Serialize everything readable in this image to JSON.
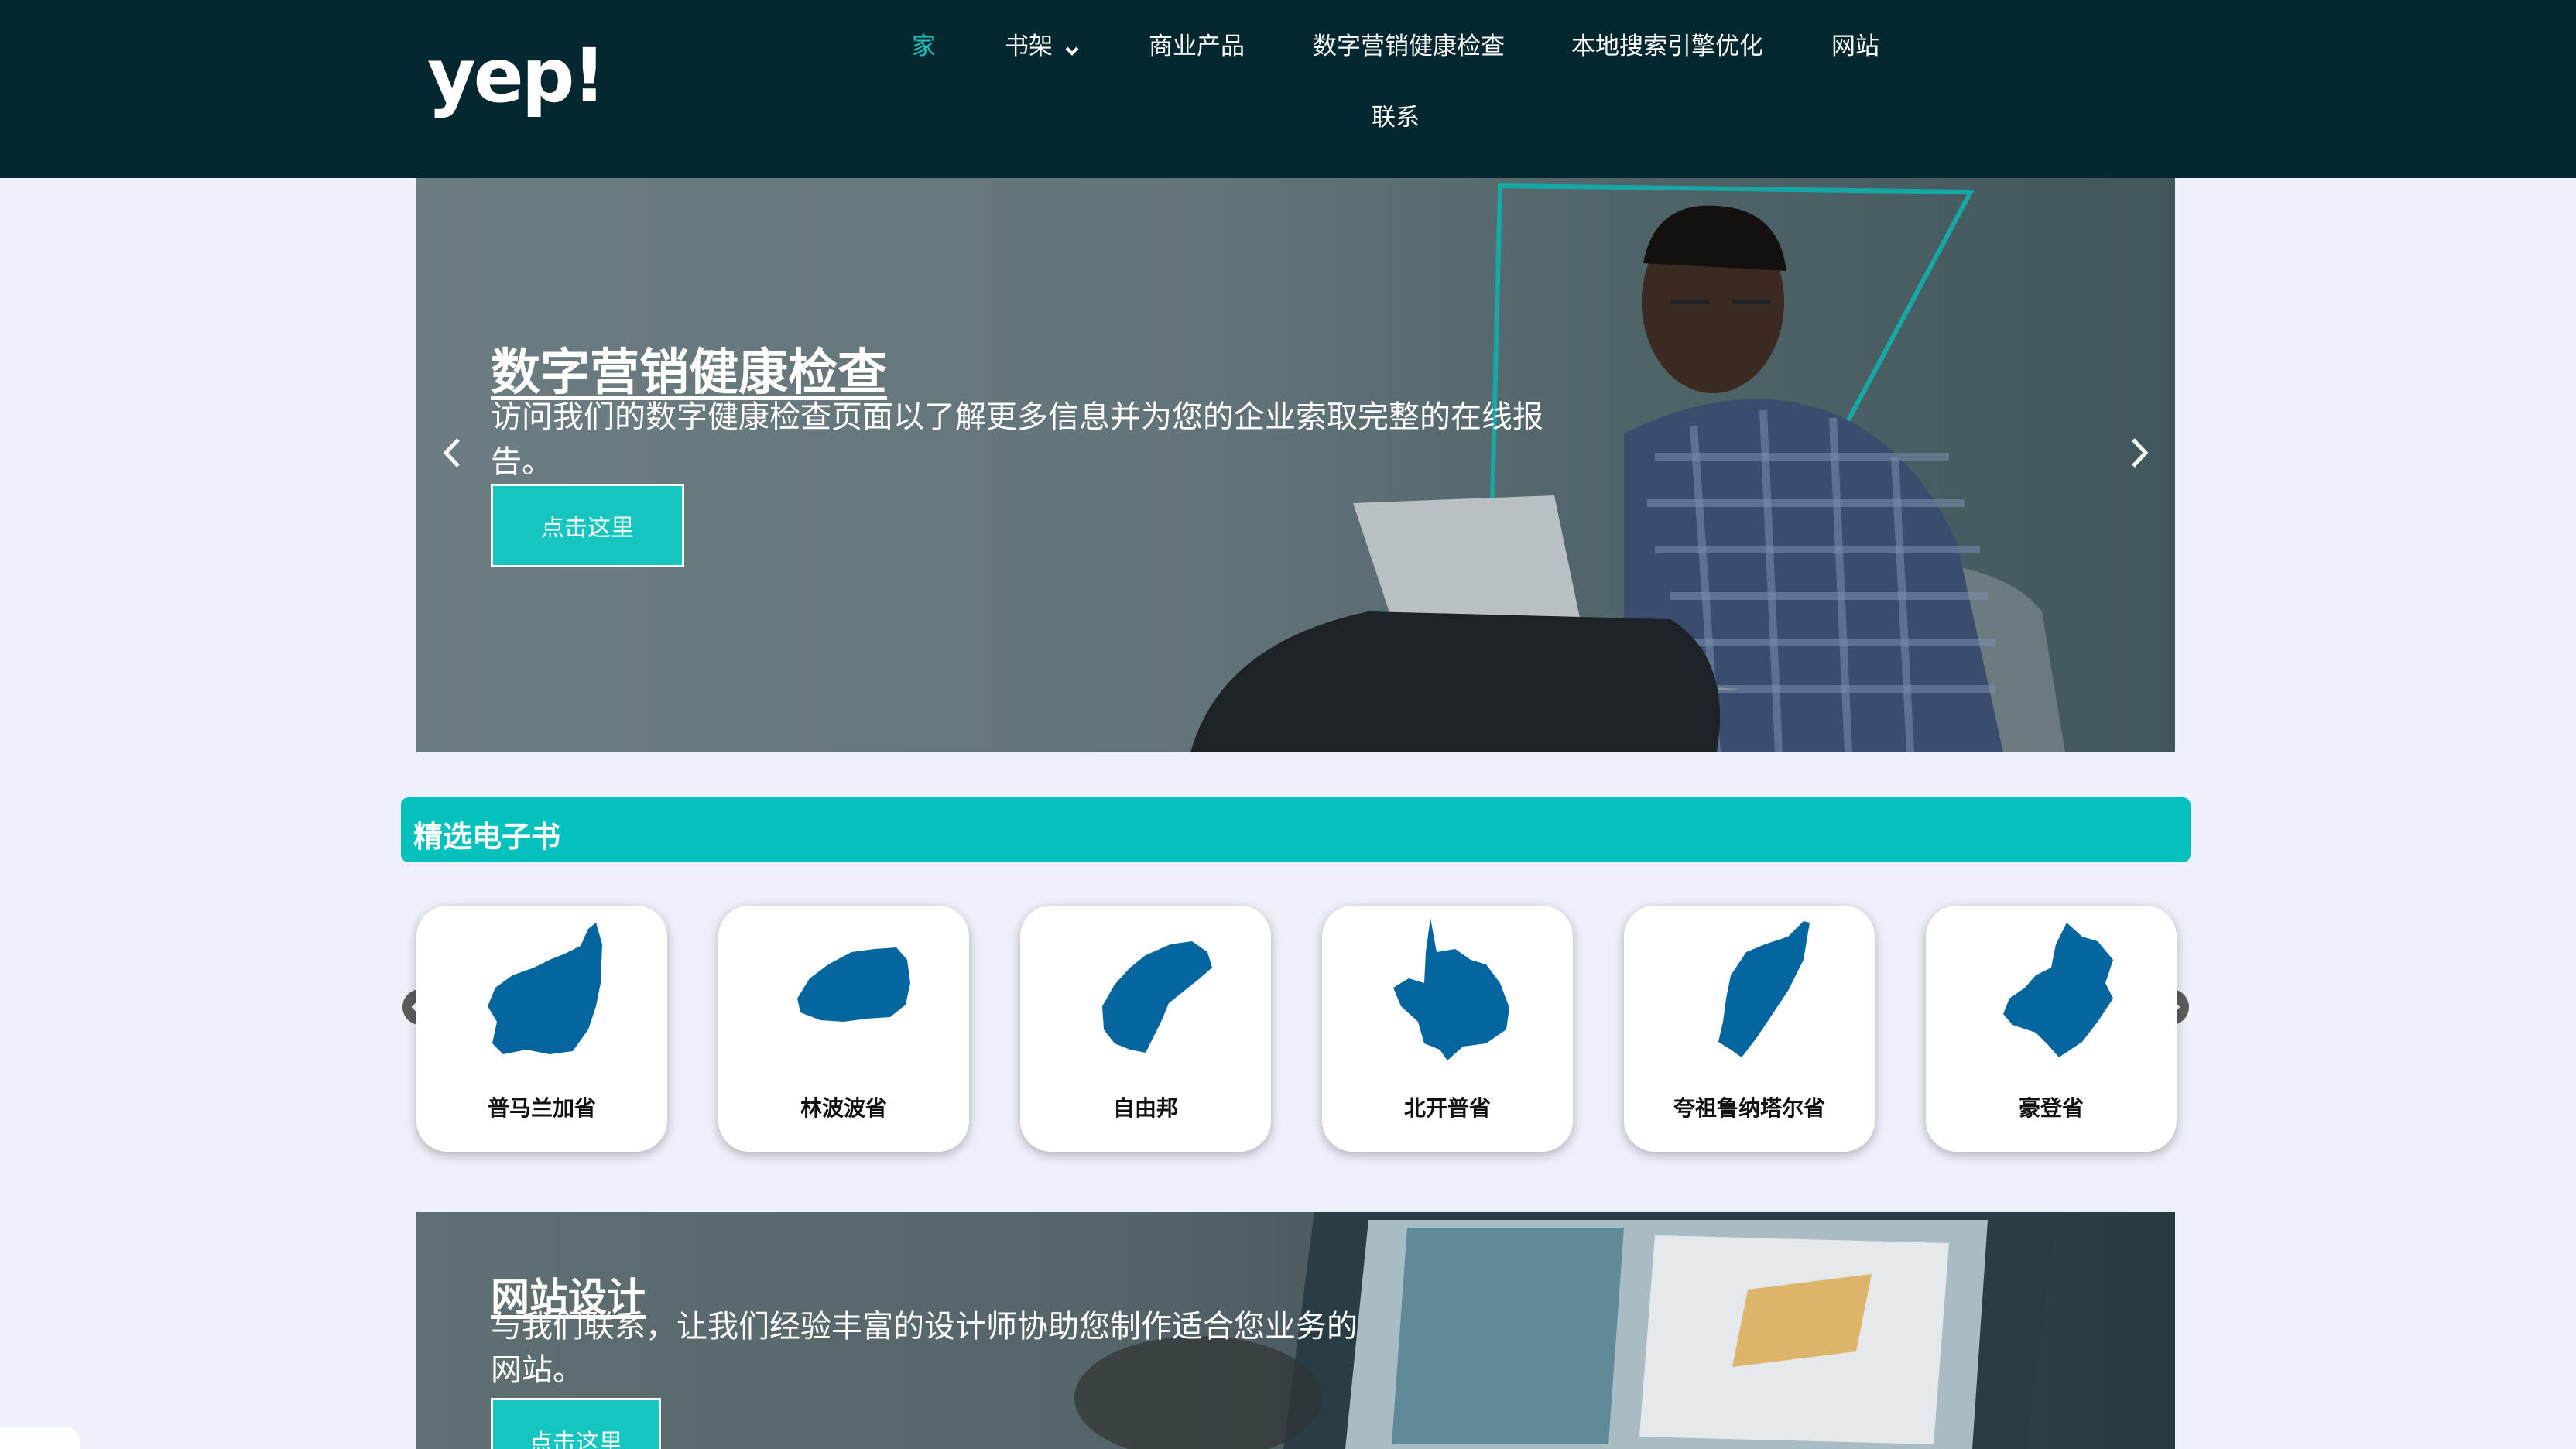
{
  "brand": {
    "logo_text": "yep!"
  },
  "nav": {
    "items": [
      {
        "label": "家",
        "active": true
      },
      {
        "label": "书架",
        "has_dropdown": true
      },
      {
        "label": "商业产品"
      },
      {
        "label": "数字营销健康检查"
      },
      {
        "label": "本地搜索引擎优化"
      },
      {
        "label": "网站"
      },
      {
        "label": "联系"
      }
    ]
  },
  "hero": {
    "title": "数字营销健康检查",
    "description": "访问我们的数字健康检查页面以了解更多信息并为您的企业索取完整的在线报告。",
    "cta_label": "点击这里"
  },
  "featured": {
    "heading": "精选电子书",
    "cards": [
      {
        "label": "普马兰加省",
        "icon": "mpumalanga-map-icon"
      },
      {
        "label": "林波波省",
        "icon": "limpopo-map-icon"
      },
      {
        "label": "自由邦",
        "icon": "free-state-map-icon"
      },
      {
        "label": "北开普省",
        "icon": "northern-cape-map-icon"
      },
      {
        "label": "夸祖鲁纳塔尔省",
        "icon": "kwazulu-natal-map-icon"
      },
      {
        "label": "豪登省",
        "icon": "gauteng-map-icon"
      }
    ]
  },
  "web_design": {
    "title": "网站设计",
    "description": "与我们联系，让我们经验丰富的设计师协助您制作适合您业务的网站。",
    "cta_label": "点击这里"
  },
  "colors": {
    "header_bg": "#042730",
    "accent": "#16c4c0",
    "section_bar": "#04c1bd",
    "map_fill": "#05659f",
    "page_bg": "#eef1f9"
  }
}
